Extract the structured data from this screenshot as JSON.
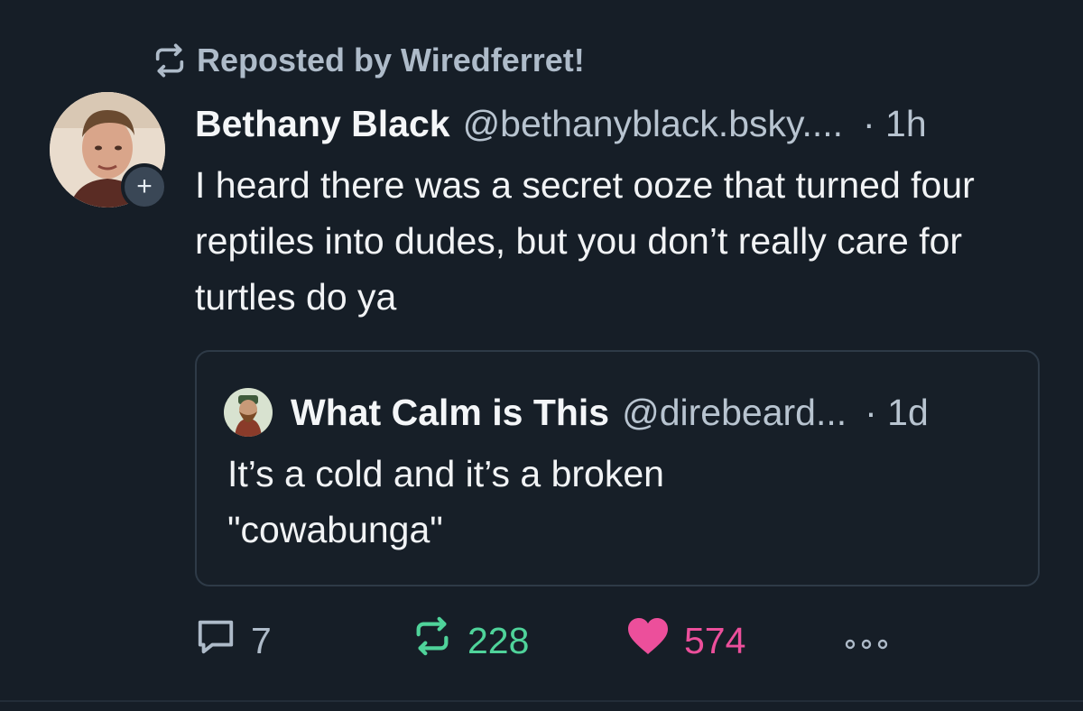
{
  "repost": {
    "label": "Reposted by Wiredferret!",
    "icon": "repost-icon"
  },
  "post": {
    "author_name": "Bethany Black",
    "author_handle": "@bethanyblack.bsky....",
    "time": "· 1h",
    "text": "I heard there was a secret ooze that turned four reptiles into dudes, but you don’t really care for turtles do ya",
    "follow_badge": "+"
  },
  "quote": {
    "author_name": "What Calm is This",
    "author_handle": "@direbeard...",
    "time": "· 1d",
    "text_line1": "It’s a cold and it’s a broken",
    "text_line2": "\"cowabunga\""
  },
  "actions": {
    "reply_count": "7",
    "repost_count": "228",
    "like_count": "574"
  },
  "colors": {
    "background": "#161e27",
    "repost_active": "#4fd39a",
    "like_active": "#ec4f9b",
    "muted": "#aebbc9"
  }
}
